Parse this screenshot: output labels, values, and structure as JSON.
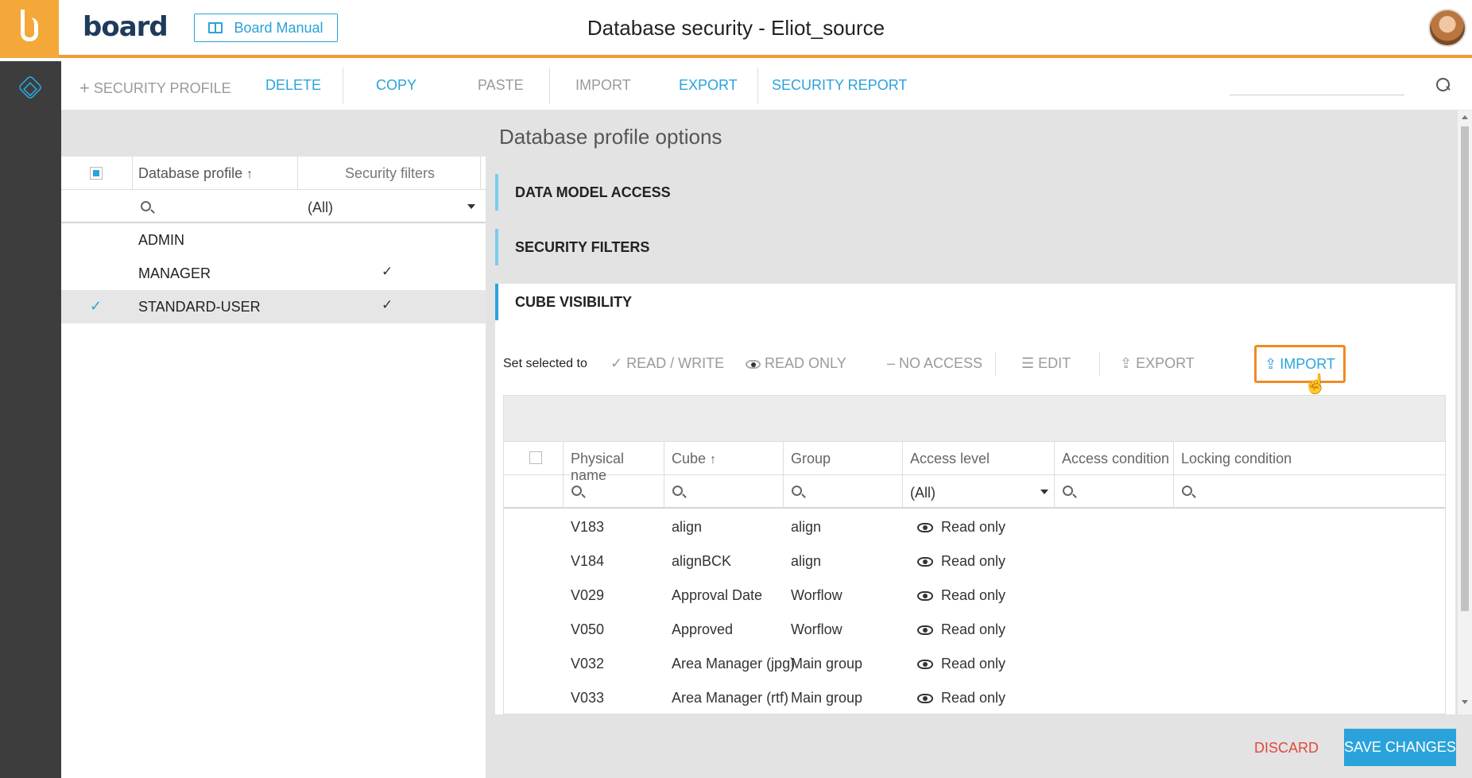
{
  "app": {
    "brand": "board",
    "manual_button": "Board Manual",
    "page_title": "Database security - Eliot_source"
  },
  "toolbar": {
    "security_profile": "SECURITY PROFILE",
    "delete": "DELETE",
    "copy": "COPY",
    "paste": "PASTE",
    "import": "IMPORT",
    "export": "EXPORT",
    "security_report": "SECURITY REPORT"
  },
  "left_panel": {
    "col_profile": "Database profile",
    "col_filters": "Security filters",
    "filter_value": "(All)",
    "rows": [
      {
        "name": "ADMIN",
        "filter": "",
        "selected": false
      },
      {
        "name": "MANAGER",
        "filter": "✓",
        "selected": false
      },
      {
        "name": "STANDARD-USER",
        "filter": "✓",
        "selected": true
      }
    ],
    "row_check": "✓"
  },
  "right_panel": {
    "title": "Database profile options",
    "sections": {
      "data_model": "DATA MODEL ACCESS",
      "security_filters": "SECURITY FILTERS",
      "cube_visibility": "CUBE VISIBILITY"
    },
    "actions": {
      "set_selected_to": "Set selected to",
      "read_write": "READ / WRITE",
      "read_only": "READ ONLY",
      "no_access": "NO ACCESS",
      "edit": "EDIT",
      "export": "EXPORT",
      "import": "IMPORT"
    },
    "grid": {
      "headers": [
        "Physical name",
        "Cube",
        "Group",
        "Access level",
        "Access condition",
        "Locking condition"
      ],
      "access_filter": "(All)",
      "rows": [
        {
          "physical": "V183",
          "cube": "align",
          "group": "align",
          "access": "Read only"
        },
        {
          "physical": "V184",
          "cube": "alignBCK",
          "group": "align",
          "access": "Read only"
        },
        {
          "physical": "V029",
          "cube": "Approval Date",
          "group": "Worflow",
          "access": "Read only"
        },
        {
          "physical": "V050",
          "cube": "Approved",
          "group": "Worflow",
          "access": "Read only"
        },
        {
          "physical": "V032",
          "cube": "Area Manager (jpg)",
          "group": "Main group",
          "access": "Read only"
        },
        {
          "physical": "V033",
          "cube": "Area Manager (rtf)",
          "group": "Main group",
          "access": "Read only"
        }
      ]
    }
  },
  "footer": {
    "discard": "DISCARD",
    "save": "SAVE CHANGES"
  },
  "colors": {
    "accent": "#2aa3dc",
    "brand_orange": "#f29b30",
    "danger": "#e2483d"
  },
  "icons": [
    "board-logo-icon",
    "book-icon",
    "cube-icon",
    "plus-icon",
    "search-icon",
    "sort-up-icon",
    "check-icon",
    "eye-icon",
    "dash-icon",
    "sliders-icon",
    "upload-icon",
    "pointer-cursor-icon",
    "caret-down-icon"
  ]
}
